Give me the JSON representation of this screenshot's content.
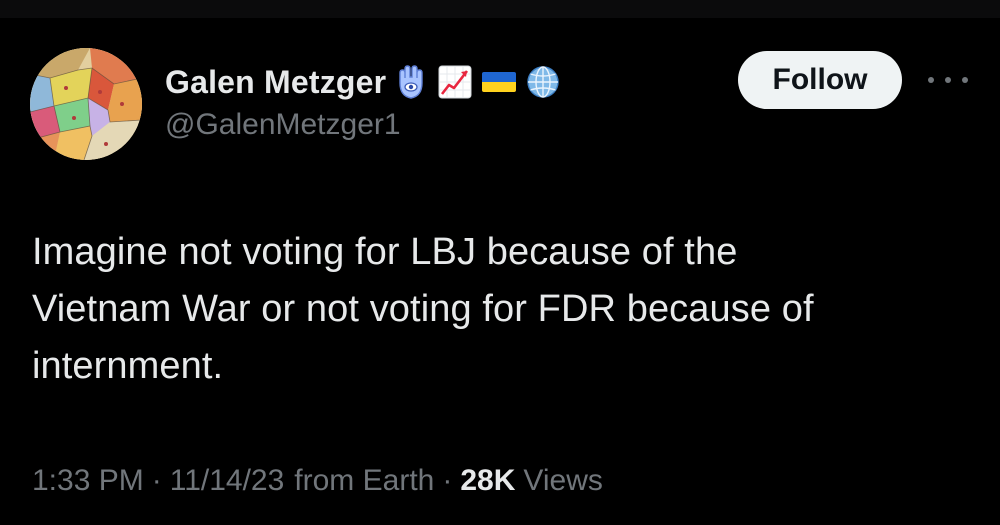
{
  "author": {
    "display_name": "Galen Metzger",
    "handle": "@GalenMetzger1",
    "badges": [
      "hamsa-icon",
      "chart-increasing-icon",
      "ukraine-flag-icon",
      "globe-icon"
    ]
  },
  "actions": {
    "follow_label": "Follow",
    "more_icon": "more-horizontal-icon"
  },
  "tweet": {
    "text_lines": [
      "Imagine not voting for LBJ because of the",
      "Vietnam War or not voting for FDR because of",
      "internment."
    ],
    "time": "1:33 PM",
    "date": "11/14/23",
    "source": "from Earth",
    "separator": "·",
    "views_count": "28K",
    "views_label": "Views"
  },
  "colors": {
    "background": "#000000",
    "primary_text": "#e7e9ea",
    "secondary_text": "#71767b",
    "follow_button_bg": "#eff3f4",
    "follow_button_text": "#0f1419"
  }
}
